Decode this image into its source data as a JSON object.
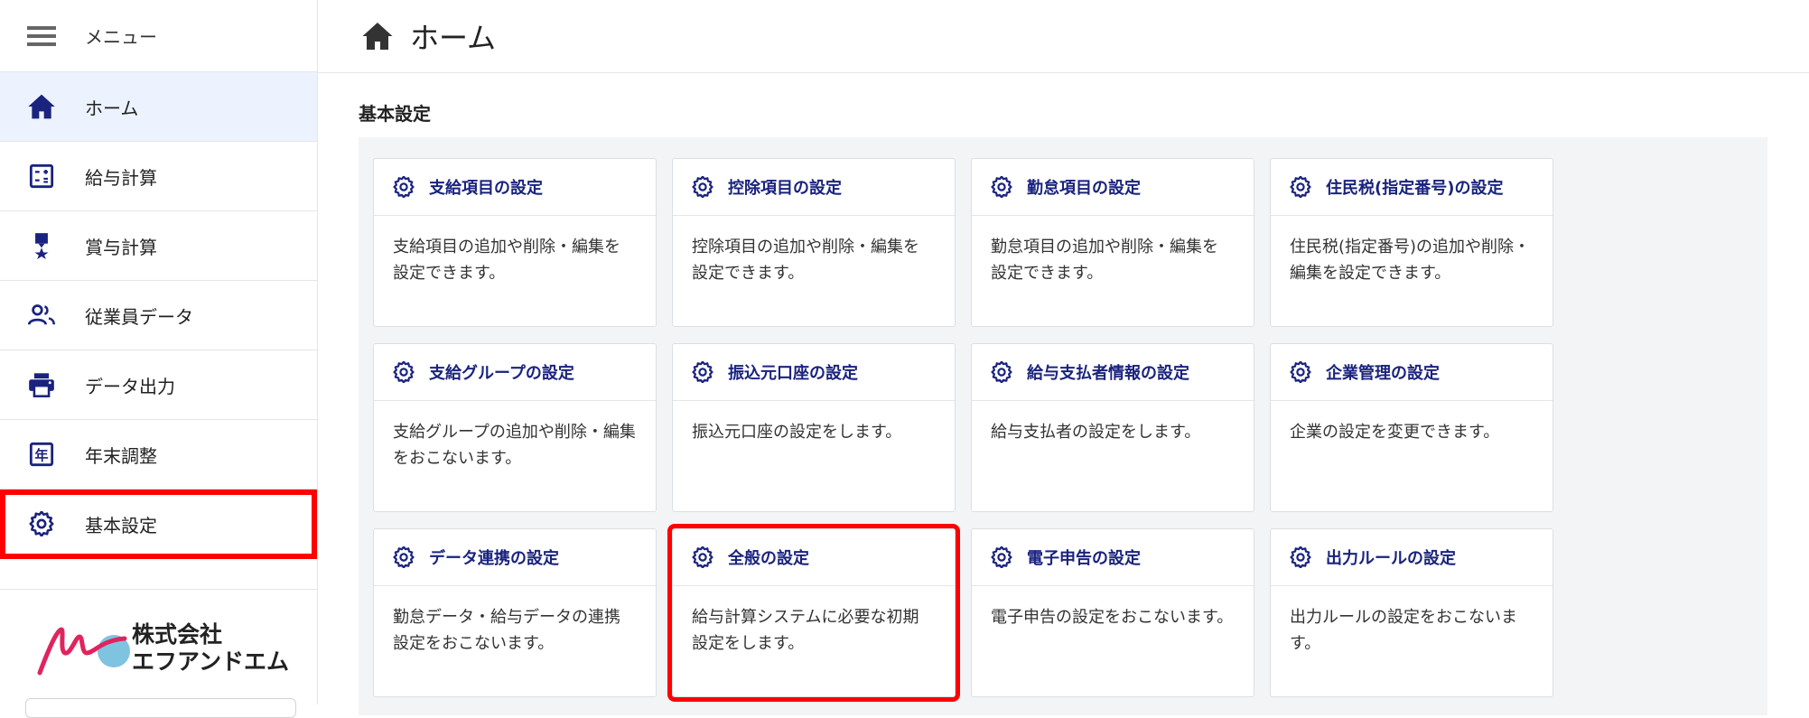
{
  "sidebar": {
    "menu_label": "メニュー",
    "items": [
      {
        "label": "ホーム",
        "icon": "home-icon"
      },
      {
        "label": "給与計算",
        "icon": "calculator-icon"
      },
      {
        "label": "賞与計算",
        "icon": "medal-icon"
      },
      {
        "label": "従業員データ",
        "icon": "people-icon"
      },
      {
        "label": "データ出力",
        "icon": "printer-icon"
      },
      {
        "label": "年末調整",
        "icon": "calendar-year-icon"
      },
      {
        "label": "基本設定",
        "icon": "gear-icon"
      }
    ],
    "logo": {
      "line1": "株式会社",
      "line2": "エフアンドエム"
    }
  },
  "header": {
    "title": "ホーム",
    "icon": "home-icon"
  },
  "main": {
    "section_title": "基本設定",
    "cards": [
      {
        "title": "支給項目の設定",
        "desc": "支給項目の追加や削除・編集を設定できます。"
      },
      {
        "title": "控除項目の設定",
        "desc": "控除項目の追加や削除・編集を設定できます。"
      },
      {
        "title": "勤怠項目の設定",
        "desc": "勤怠項目の追加や削除・編集を設定できます。"
      },
      {
        "title": "住民税(指定番号)の設定",
        "desc": "住民税(指定番号)の追加や削除・編集を設定できます。"
      },
      {
        "title": "支給グループの設定",
        "desc": "支給グループの追加や削除・編集をおこないます。"
      },
      {
        "title": "振込元口座の設定",
        "desc": "振込元口座の設定をします。"
      },
      {
        "title": "給与支払者情報の設定",
        "desc": "給与支払者の設定をします。"
      },
      {
        "title": "企業管理の設定",
        "desc": "企業の設定を変更できます。"
      },
      {
        "title": "データ連携の設定",
        "desc": "勤怠データ・給与データの連携設定をおこないます。"
      },
      {
        "title": "全般の設定",
        "desc": "給与計算システムに必要な初期設定をします。"
      },
      {
        "title": "電子申告の設定",
        "desc": "電子申告の設定をおこないます。"
      },
      {
        "title": "出力ルールの設定",
        "desc": "出力ルールの設定をおこないます。"
      }
    ]
  },
  "colors": {
    "accent": "#1a237e",
    "highlight": "#ff0000",
    "active_bg": "#edf3fe"
  }
}
